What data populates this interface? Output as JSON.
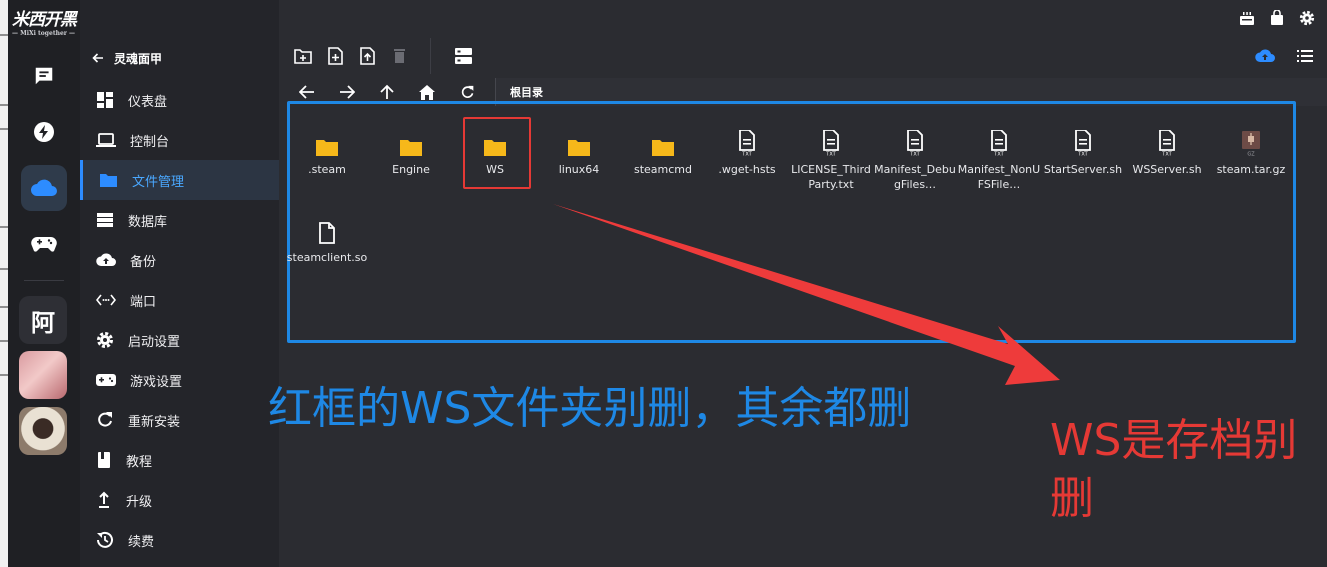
{
  "app": {
    "logo_text": "米西开黑",
    "logo_subtext": "— MiXi together —"
  },
  "rail": {
    "items": [
      {
        "icon": "chat-icon"
      },
      {
        "icon": "bolt-circle-icon"
      },
      {
        "icon": "cloud-icon",
        "active": true
      },
      {
        "icon": "gamepad-icon"
      }
    ],
    "text_avatar": "阿"
  },
  "sidebar": {
    "header": "灵魂面甲",
    "items": [
      {
        "label": "仪表盘",
        "icon": "dashboard-icon"
      },
      {
        "label": "控制台",
        "icon": "laptop-icon"
      },
      {
        "label": "文件管理",
        "icon": "folder-icon",
        "active": true
      },
      {
        "label": "数据库",
        "icon": "database-icon"
      },
      {
        "label": "备份",
        "icon": "cloud-upload-icon"
      },
      {
        "label": "端口",
        "icon": "port-icon"
      },
      {
        "label": "启动设置",
        "icon": "gear-icon"
      },
      {
        "label": "游戏设置",
        "icon": "gamepad-icon"
      },
      {
        "label": "重新安装",
        "icon": "refresh-icon"
      },
      {
        "label": "教程",
        "icon": "book-icon"
      },
      {
        "label": "升级",
        "icon": "upgrade-icon"
      },
      {
        "label": "续费",
        "icon": "renew-icon"
      }
    ]
  },
  "topbar": {
    "icons": [
      "cake-icon",
      "bag-icon",
      "gear-icon"
    ]
  },
  "toolbar": {
    "left": [
      "new-folder-icon",
      "new-file-icon",
      "upload-icon",
      "delete-icon"
    ],
    "right": [
      "server-icon"
    ],
    "far_right": [
      "cloud-upload-icon",
      "list-view-icon"
    ]
  },
  "navbar": {
    "buttons": [
      "back-arrow-icon",
      "forward-arrow-icon",
      "up-arrow-icon",
      "home-icon",
      "refresh-icon"
    ],
    "path": "根目录"
  },
  "files": [
    {
      "name": ".steam",
      "type": "folder"
    },
    {
      "name": "Engine",
      "type": "folder"
    },
    {
      "name": "WS",
      "type": "folder",
      "highlighted": true
    },
    {
      "name": "linux64",
      "type": "folder"
    },
    {
      "name": "steamcmd",
      "type": "folder"
    },
    {
      "name": ".wget-hsts",
      "type": "txt"
    },
    {
      "name": "LICENSE_ThirdParty.txt",
      "type": "txt"
    },
    {
      "name": "Manifest_DebugFiles…",
      "type": "txt"
    },
    {
      "name": "Manifest_NonUFSFile…",
      "type": "txt"
    },
    {
      "name": "StartServer.sh",
      "type": "txt"
    },
    {
      "name": "WSServer.sh",
      "type": "txt"
    },
    {
      "name": "steam.tar.gz",
      "type": "archive"
    },
    {
      "name": "steamclient.so",
      "type": "file"
    }
  ],
  "annotations": {
    "blue_note": "红框的WS文件夹别删，其余都删",
    "red_note": "WS是存档别删"
  },
  "colors": {
    "accent_blue": "#1e88e5",
    "annotation_red": "#e53935",
    "folder_yellow": "#f6b81a"
  }
}
